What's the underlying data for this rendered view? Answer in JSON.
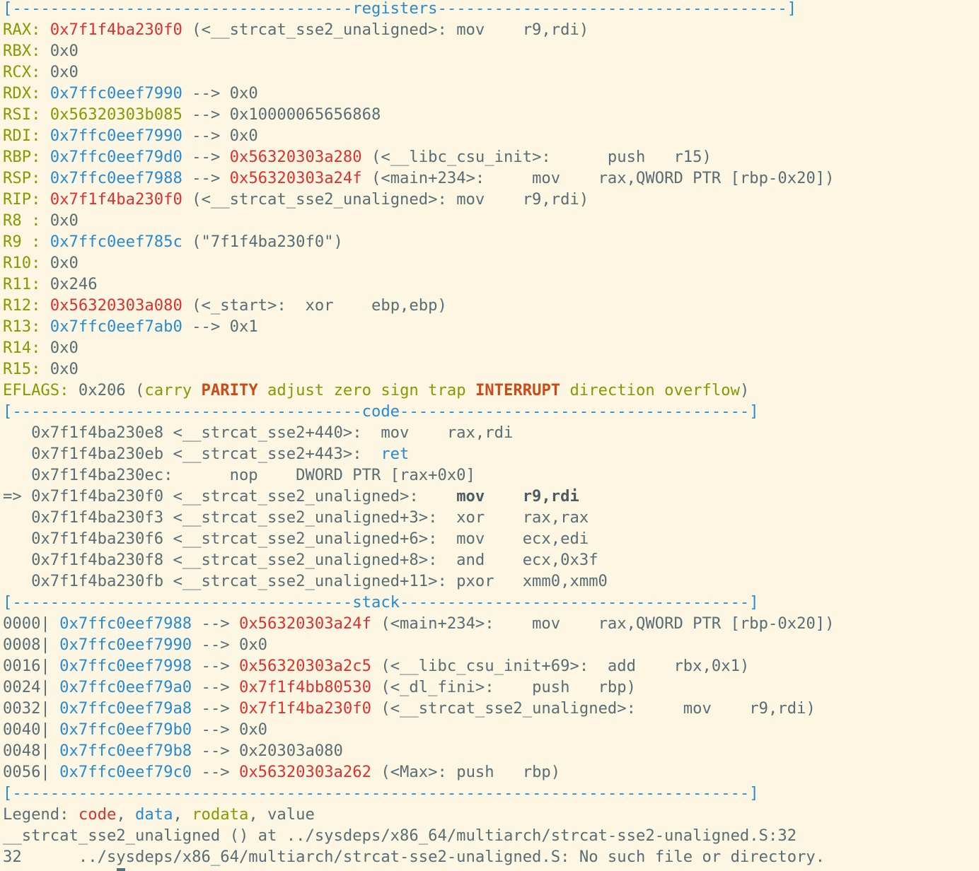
{
  "colors": {
    "background": "#fdf6e3",
    "default_text": "#586e75",
    "blue_code_or_data": "#268bd2",
    "red_code": "#dc322f",
    "green_rodata_or_label": "#859900",
    "orange_set_flag": "#cb4b16"
  },
  "lines": [
    [
      {
        "t": "[------------------------------------",
        "c": "b"
      },
      {
        "t": "registers",
        "c": "b"
      },
      {
        "t": "-------------------------------------]",
        "c": "b"
      }
    ],
    [
      {
        "t": "RAX:",
        "c": "g"
      },
      {
        "t": " ",
        "c": "d"
      },
      {
        "t": "0x7f1f4ba230f0",
        "c": "r"
      },
      {
        "t": " (<__strcat_sse2_unaligned>: mov    r9,rdi)",
        "c": "d"
      }
    ],
    [
      {
        "t": "RBX:",
        "c": "g"
      },
      {
        "t": " 0x0",
        "c": "d"
      }
    ],
    [
      {
        "t": "RCX:",
        "c": "g"
      },
      {
        "t": " 0x0",
        "c": "d"
      }
    ],
    [
      {
        "t": "RDX:",
        "c": "g"
      },
      {
        "t": " ",
        "c": "d"
      },
      {
        "t": "0x7ffc0eef7990",
        "c": "b"
      },
      {
        "t": " --> 0x0",
        "c": "d"
      }
    ],
    [
      {
        "t": "RSI:",
        "c": "g"
      },
      {
        "t": " ",
        "c": "d"
      },
      {
        "t": "0x56320303b085",
        "c": "g"
      },
      {
        "t": " --> 0x10000065656868",
        "c": "d"
      }
    ],
    [
      {
        "t": "RDI:",
        "c": "g"
      },
      {
        "t": " ",
        "c": "d"
      },
      {
        "t": "0x7ffc0eef7990",
        "c": "b"
      },
      {
        "t": " --> 0x0",
        "c": "d"
      }
    ],
    [
      {
        "t": "RBP:",
        "c": "g"
      },
      {
        "t": " ",
        "c": "d"
      },
      {
        "t": "0x7ffc0eef79d0",
        "c": "b"
      },
      {
        "t": " --> ",
        "c": "d"
      },
      {
        "t": "0x56320303a280",
        "c": "r"
      },
      {
        "t": " (<__libc_csu_init>:      push   r15)",
        "c": "d"
      }
    ],
    [
      {
        "t": "RSP:",
        "c": "g"
      },
      {
        "t": " ",
        "c": "d"
      },
      {
        "t": "0x7ffc0eef7988",
        "c": "b"
      },
      {
        "t": " --> ",
        "c": "d"
      },
      {
        "t": "0x56320303a24f",
        "c": "r"
      },
      {
        "t": " (<main+234>:     mov    rax,QWORD PTR [rbp-0x20])",
        "c": "d"
      }
    ],
    [
      {
        "t": "RIP:",
        "c": "g"
      },
      {
        "t": " ",
        "c": "d"
      },
      {
        "t": "0x7f1f4ba230f0",
        "c": "r"
      },
      {
        "t": " (<__strcat_sse2_unaligned>: mov    r9,rdi)",
        "c": "d"
      }
    ],
    [
      {
        "t": "R8 :",
        "c": "g"
      },
      {
        "t": " 0x0",
        "c": "d"
      }
    ],
    [
      {
        "t": "R9 :",
        "c": "g"
      },
      {
        "t": " ",
        "c": "d"
      },
      {
        "t": "0x7ffc0eef785c",
        "c": "b"
      },
      {
        "t": " (\"7f1f4ba230f0\")",
        "c": "d"
      }
    ],
    [
      {
        "t": "R10:",
        "c": "g"
      },
      {
        "t": " 0x0",
        "c": "d"
      }
    ],
    [
      {
        "t": "R11:",
        "c": "g"
      },
      {
        "t": " 0x246",
        "c": "d"
      }
    ],
    [
      {
        "t": "R12:",
        "c": "g"
      },
      {
        "t": " ",
        "c": "d"
      },
      {
        "t": "0x56320303a080",
        "c": "r"
      },
      {
        "t": " (<_start>:  xor    ebp,ebp)",
        "c": "d"
      }
    ],
    [
      {
        "t": "R13:",
        "c": "g"
      },
      {
        "t": " ",
        "c": "d"
      },
      {
        "t": "0x7ffc0eef7ab0",
        "c": "b"
      },
      {
        "t": " --> 0x1",
        "c": "d"
      }
    ],
    [
      {
        "t": "R14:",
        "c": "g"
      },
      {
        "t": " 0x0",
        "c": "d"
      }
    ],
    [
      {
        "t": "R15:",
        "c": "g"
      },
      {
        "t": " 0x0",
        "c": "d"
      }
    ],
    [
      {
        "t": "EFLAGS:",
        "c": "g"
      },
      {
        "t": " 0x206 (",
        "c": "d"
      },
      {
        "t": "carry ",
        "c": "g"
      },
      {
        "t": "PARITY",
        "c": "o"
      },
      {
        "t": " adjust zero sign trap ",
        "c": "g"
      },
      {
        "t": "INTERRUPT",
        "c": "o"
      },
      {
        "t": " direction overflow",
        "c": "g"
      },
      {
        "t": ")",
        "c": "d"
      }
    ],
    [
      {
        "t": "[-------------------------------------",
        "c": "b"
      },
      {
        "t": "code",
        "c": "b"
      },
      {
        "t": "-------------------------------------]",
        "c": "b"
      }
    ],
    [
      {
        "t": "   0x7f1f4ba230e8 <__strcat_sse2+440>:  mov    rax,rdi",
        "c": "d"
      }
    ],
    [
      {
        "t": "   0x7f1f4ba230eb <__strcat_sse2+443>:  ",
        "c": "d"
      },
      {
        "t": "ret",
        "c": "b"
      }
    ],
    [
      {
        "t": "   0x7f1f4ba230ec:      nop    DWORD PTR [rax+0x0]",
        "c": "d"
      }
    ],
    [
      {
        "t": "=> 0x7f1f4ba230f0 <__strcat_sse2_unaligned>:    ",
        "c": "d"
      },
      {
        "t": "mov    r9,rdi",
        "c": "cur"
      }
    ],
    [
      {
        "t": "   0x7f1f4ba230f3 <__strcat_sse2_unaligned+3>:  xor    rax,rax",
        "c": "d"
      }
    ],
    [
      {
        "t": "   0x7f1f4ba230f6 <__strcat_sse2_unaligned+6>:  mov    ecx,edi",
        "c": "d"
      }
    ],
    [
      {
        "t": "   0x7f1f4ba230f8 <__strcat_sse2_unaligned+8>:  and    ecx,0x3f",
        "c": "d"
      }
    ],
    [
      {
        "t": "   0x7f1f4ba230fb <__strcat_sse2_unaligned+11>: pxor   xmm0,xmm0",
        "c": "d"
      }
    ],
    [
      {
        "t": "[------------------------------------",
        "c": "b"
      },
      {
        "t": "stack",
        "c": "b"
      },
      {
        "t": "-------------------------------------]",
        "c": "b"
      }
    ],
    [
      {
        "t": "0000| ",
        "c": "d"
      },
      {
        "t": "0x7ffc0eef7988",
        "c": "b"
      },
      {
        "t": " --> ",
        "c": "d"
      },
      {
        "t": "0x56320303a24f",
        "c": "r"
      },
      {
        "t": " (<main+234>:    mov    rax,QWORD PTR [rbp-0x20])",
        "c": "d"
      }
    ],
    [
      {
        "t": "0008| ",
        "c": "d"
      },
      {
        "t": "0x7ffc0eef7990",
        "c": "b"
      },
      {
        "t": " --> 0x0",
        "c": "d"
      }
    ],
    [
      {
        "t": "0016| ",
        "c": "d"
      },
      {
        "t": "0x7ffc0eef7998",
        "c": "b"
      },
      {
        "t": " --> ",
        "c": "d"
      },
      {
        "t": "0x56320303a2c5",
        "c": "r"
      },
      {
        "t": " (<__libc_csu_init+69>:  add    rbx,0x1)",
        "c": "d"
      }
    ],
    [
      {
        "t": "0024| ",
        "c": "d"
      },
      {
        "t": "0x7ffc0eef79a0",
        "c": "b"
      },
      {
        "t": " --> ",
        "c": "d"
      },
      {
        "t": "0x7f1f4bb80530",
        "c": "r"
      },
      {
        "t": " (<_dl_fini>:    push   rbp)",
        "c": "d"
      }
    ],
    [
      {
        "t": "0032| ",
        "c": "d"
      },
      {
        "t": "0x7ffc0eef79a8",
        "c": "b"
      },
      {
        "t": " --> ",
        "c": "d"
      },
      {
        "t": "0x7f1f4ba230f0",
        "c": "r"
      },
      {
        "t": " (<__strcat_sse2_unaligned>:     mov    r9,rdi)",
        "c": "d"
      }
    ],
    [
      {
        "t": "0040| ",
        "c": "d"
      },
      {
        "t": "0x7ffc0eef79b0",
        "c": "b"
      },
      {
        "t": " --> 0x0",
        "c": "d"
      }
    ],
    [
      {
        "t": "0048| ",
        "c": "d"
      },
      {
        "t": "0x7ffc0eef79b8",
        "c": "b"
      },
      {
        "t": " --> 0x20303a080",
        "c": "d"
      }
    ],
    [
      {
        "t": "0056| ",
        "c": "d"
      },
      {
        "t": "0x7ffc0eef79c0",
        "c": "b"
      },
      {
        "t": " --> ",
        "c": "d"
      },
      {
        "t": "0x56320303a262",
        "c": "r"
      },
      {
        "t": " (<Max>: push   rbp)",
        "c": "d"
      }
    ],
    [
      {
        "t": "[------------------------------------------------------------------------------]",
        "c": "b"
      }
    ],
    [
      {
        "t": "Legend: ",
        "c": "d"
      },
      {
        "t": "code",
        "c": "r"
      },
      {
        "t": ", ",
        "c": "d"
      },
      {
        "t": "data",
        "c": "b"
      },
      {
        "t": ", ",
        "c": "d"
      },
      {
        "t": "rodata",
        "c": "g"
      },
      {
        "t": ", value",
        "c": "d"
      }
    ],
    [
      {
        "t": "__strcat_sse2_unaligned () at ../sysdeps/x86_64/multiarch/strcat-sse2-unaligned.S:32",
        "c": "d"
      }
    ],
    [
      {
        "t": "32\t../sysdeps/x86_64/multiarch/strcat-sse2-unaligned.S: No such file or directory.",
        "c": "d"
      }
    ]
  ]
}
